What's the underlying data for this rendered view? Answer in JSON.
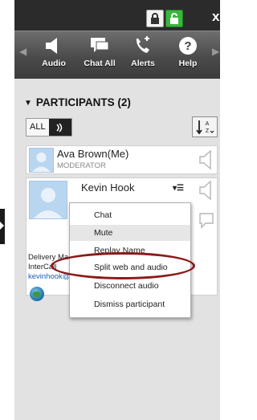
{
  "window": {
    "lock_icon": "lock-icon",
    "unlock_icon": "unlock-icon",
    "close_label": "x"
  },
  "toolbar": {
    "items": [
      {
        "label": "Audio",
        "icon": "speaker-icon"
      },
      {
        "label": "Chat All",
        "icon": "chat-icon"
      },
      {
        "label": "Alerts",
        "icon": "phone-alert-icon"
      },
      {
        "label": "Help",
        "icon": "help-icon"
      }
    ]
  },
  "participants": {
    "header": "PARTICIPANTS (2)",
    "filter_label": "ALL",
    "sort_label": "A Z",
    "list": [
      {
        "name": "Ava Brown(Me)",
        "role": "MODERATOR"
      },
      {
        "name": "Kevin Hook",
        "menu_glyph": "▾☰",
        "details": [
          "Delivery Ma",
          "InterCall",
          "kevinhook@"
        ]
      }
    ]
  },
  "context_menu": {
    "items": [
      "Chat",
      "Mute",
      "Replay Name",
      "Split web and audio",
      "Disconnect audio",
      "Dismiss participant"
    ],
    "hovered_index": 1,
    "circled_index": 3
  },
  "colors": {
    "toolbar": "#4a4a4a",
    "panel": "#e2e2e2",
    "unlock": "#3ab63e",
    "link": "#1b5fb0",
    "annotation": "#8b1a1a"
  }
}
